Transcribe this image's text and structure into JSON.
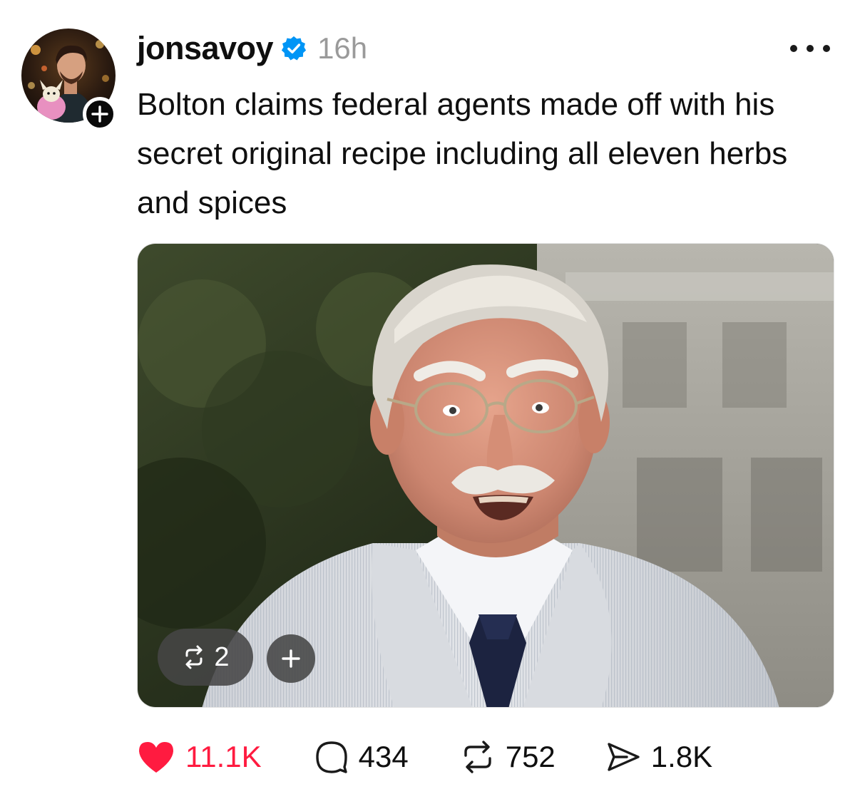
{
  "post": {
    "username": "jonsavoy",
    "timestamp": "16h",
    "text": "Bolton claims federal agents made off with his secret original recipe including all eleven herbs and spices",
    "media": {
      "repost_count": "2"
    },
    "actions": {
      "likes": "11.1K",
      "replies": "434",
      "reposts": "752",
      "shares": "1.8K"
    }
  },
  "colors": {
    "like_red": "#ff1b40",
    "verified_blue": "#0095f6",
    "timestamp_gray": "#9a9a9a"
  },
  "icons": {
    "verified": "verified-badge-icon",
    "more": "more-dots-icon",
    "follow": "plus-icon",
    "like": "heart-icon",
    "reply": "comment-bubble-icon",
    "repost": "repost-icon",
    "share": "send-icon"
  }
}
